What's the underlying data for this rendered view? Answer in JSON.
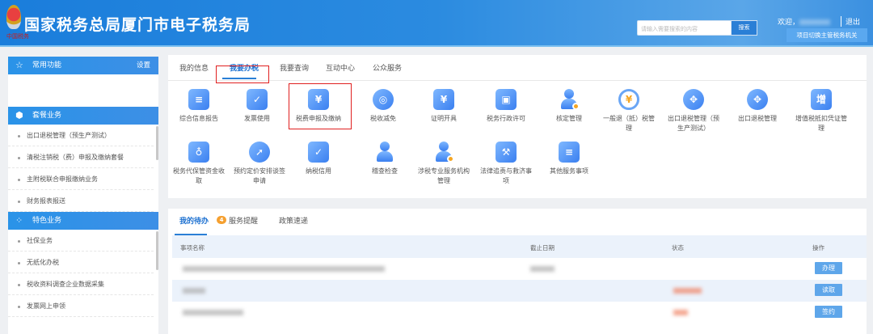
{
  "header": {
    "title": "国家税务总局厦门市电子税务局",
    "slogan": "中国税务",
    "search_placeholder": "请输入需要搜索的内容",
    "search_button": "搜索",
    "welcome": "欢迎，",
    "logout": "退出",
    "switch_button": "项目切换主管税务机关"
  },
  "sidebar": {
    "common": {
      "title": "常用功能",
      "settings": "设置"
    },
    "package": {
      "title": "套餐业务",
      "items": [
        "出口退税管理（预生产测试）",
        "清税注销税（费）申报及缴纳套餐",
        "主附税联合申报缴纳业务",
        "财务报表报送"
      ]
    },
    "special": {
      "title": "特色业务",
      "items": [
        "社保业务",
        "无纸化办税",
        "税收资料调查企业数据采集",
        "发票网上申领"
      ]
    }
  },
  "main": {
    "tabs": [
      "我的信息",
      "我要办税",
      "我要查询",
      "互动中心",
      "公众服务"
    ],
    "active_tab": "我要办税",
    "services": [
      {
        "label": "综合信息报告",
        "icon": "clipboard-icon"
      },
      {
        "label": "发票使用",
        "icon": "ticket-check-icon"
      },
      {
        "label": "税费申报及缴纳",
        "icon": "wallet-yuan-icon"
      },
      {
        "label": "税收减免",
        "icon": "coin-stack-icon"
      },
      {
        "label": "证明开具",
        "icon": "yuan-ticket-icon"
      },
      {
        "label": "税务行政许可",
        "icon": "id-card-icon"
      },
      {
        "label": "核定管理",
        "icon": "person-gear-icon"
      },
      {
        "label": "一般退（抵）税管理",
        "icon": "yuan-refresh-icon"
      },
      {
        "label": "出口退税管理（预生产测试）",
        "icon": "globe-icon"
      },
      {
        "label": "出口退税管理",
        "icon": "globe-icon"
      },
      {
        "label": "增值税抵扣凭证管理",
        "icon": "vat-ticket-icon"
      },
      {
        "label": "税务代保管资金收取",
        "icon": "money-bag-hand-icon"
      },
      {
        "label": "预约定价安排谈签申请",
        "icon": "compass-icon"
      },
      {
        "label": "纳税信用",
        "icon": "diamond-check-icon"
      },
      {
        "label": "稽查检查",
        "icon": "stamp-icon"
      },
      {
        "label": "涉税专业服务机构管理",
        "icon": "person-gear-icon"
      },
      {
        "label": "法律追责与救济事项",
        "icon": "gavel-icon"
      },
      {
        "label": "其他服务事项",
        "icon": "clipboard-icon"
      }
    ]
  },
  "todo": {
    "tabs": [
      "我的待办",
      "服务提醒",
      "政策速递"
    ],
    "badge": "4",
    "columns": [
      "事项名称",
      "截止日期",
      "状态",
      "操作"
    ],
    "actions": [
      "办理",
      "读取",
      "签约"
    ]
  }
}
